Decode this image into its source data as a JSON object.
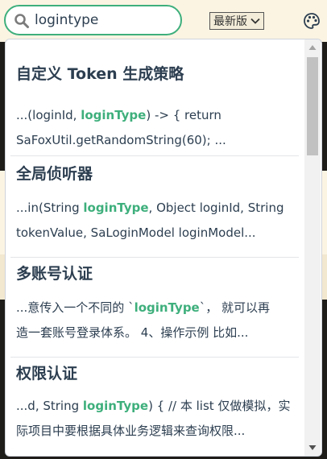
{
  "search": {
    "value": "logintype"
  },
  "version_select": {
    "label": "最新版"
  },
  "icons": {
    "search": "search-icon",
    "chevron": "chevron-down-icon",
    "theme": "palette-icon"
  },
  "colors": {
    "accent": "#3eaf7c",
    "text": "#2c3e50",
    "page_bg": "#fbf4e3"
  },
  "suggestions": [
    {
      "title": "自定义 Token 生成策略",
      "line1": {
        "before": "...(loginId, ",
        "match": "loginType",
        "after": ") -> { return"
      },
      "line2": "SaFoxUtil.getRandomString(60); ..."
    },
    {
      "title": "全局侦听器",
      "line1": {
        "before": "...in(String ",
        "match": "loginType",
        "after": ", Object loginId, String"
      },
      "line2": "tokenValue, SaLoginModel loginModel..."
    },
    {
      "title": "多账号认证",
      "line1": {
        "before": "...意传入一个不同的 `",
        "match": "loginType",
        "after": "`， 就可以再"
      },
      "line2": "造一套账号登录体系。 4、操作示例 比如..."
    },
    {
      "title": "权限认证",
      "line1": {
        "before": "...d, String ",
        "match": "loginType",
        "after": ") { // 本 list 仅做模拟，实"
      },
      "line2": "际项目中要根据具体业务逻辑来查询权限..."
    }
  ]
}
